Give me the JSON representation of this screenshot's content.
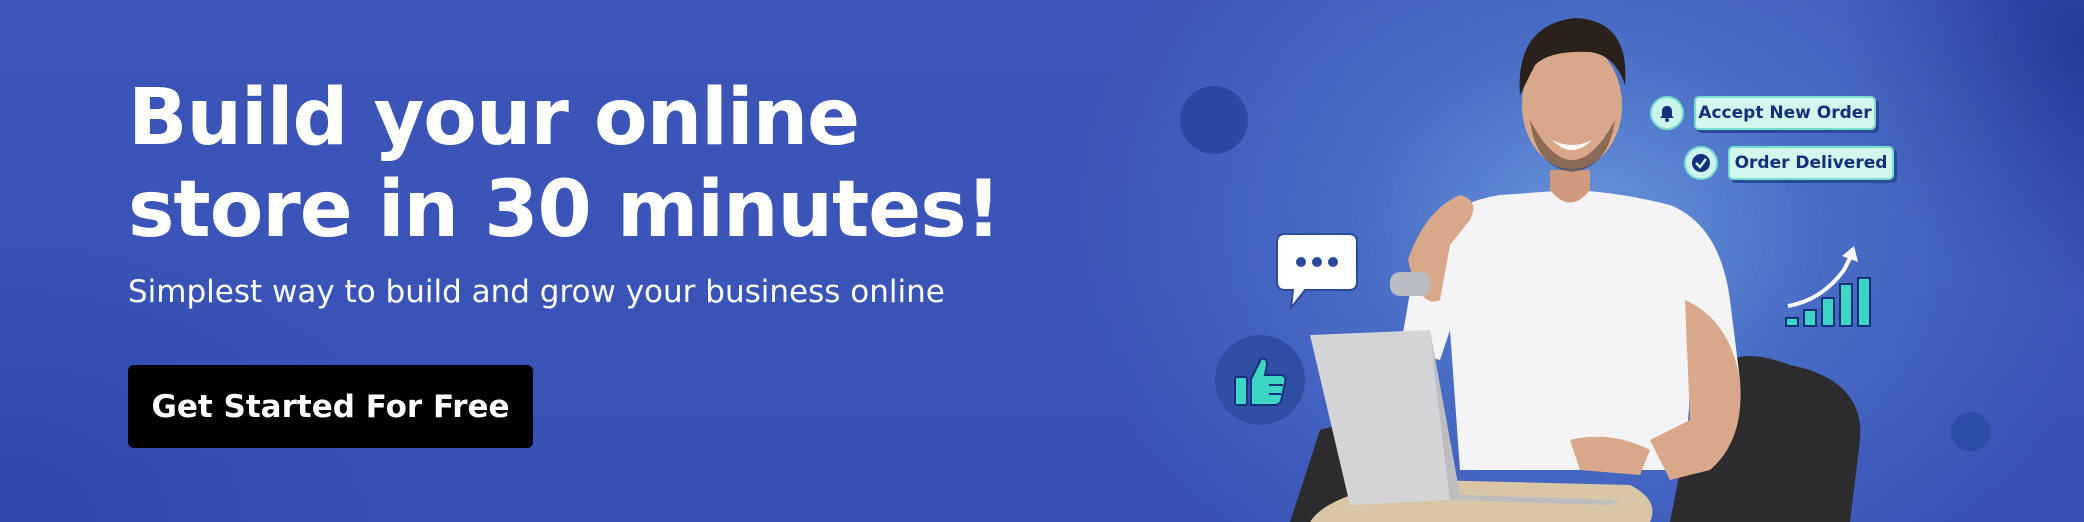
{
  "hero": {
    "headline_line1": "Build your online",
    "headline_line2": "store in 30 minutes!",
    "subheadline": "Simplest way to build and grow your business online",
    "cta_label": "Get Started For Free"
  },
  "notifications": {
    "accept_label": "Accept New Order",
    "delivered_label": "Order Delivered"
  },
  "icons": [
    "chat-bubble-icon",
    "thumbs-up-icon",
    "bell-icon",
    "checkmark-icon",
    "growth-chart-icon"
  ],
  "colors": {
    "background": "#3a54b7",
    "cta_background": "#000000",
    "accent_teal": "#3dd6c4",
    "pill_background": "#d3f6ee",
    "pill_text": "#14307a"
  }
}
